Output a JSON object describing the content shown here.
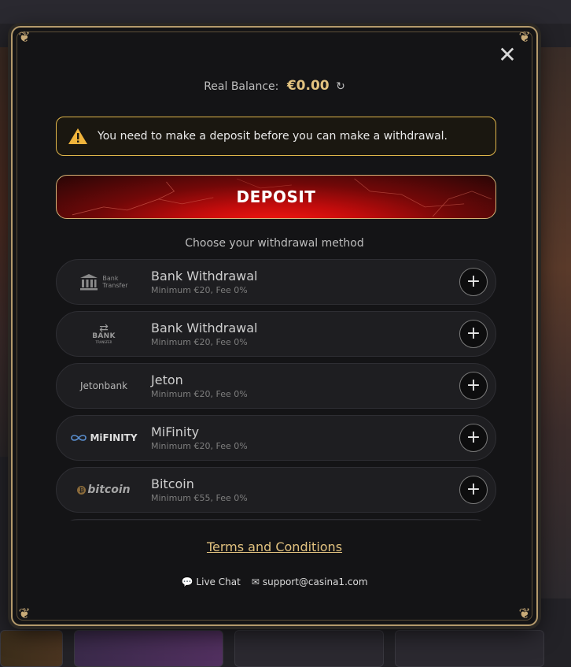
{
  "modal": {
    "close_icon": "close-icon",
    "balance": {
      "label": "Real Balance:",
      "amount": "€0.00",
      "refresh_icon": "refresh-icon"
    },
    "warning": {
      "icon": "warning-triangle-icon",
      "text": "You need to make a deposit before you can make a withdrawal.",
      "border_color": "#e0b54a"
    },
    "deposit_button": "DEPOSIT",
    "choose_label": "Choose your withdrawal method",
    "methods": [
      {
        "logo": "bank-transfer-logo",
        "logo_text": [
          "Bank",
          "Transfer"
        ],
        "name": "Bank Withdrawal",
        "minimum": "Minimum €20,",
        "fee": "Fee 0%"
      },
      {
        "logo": "bank-transfer-2-logo",
        "logo_text": [
          "BANK",
          "TRANSFER"
        ],
        "name": "Bank Withdrawal",
        "minimum": "Minimum €20,",
        "fee": "Fee 0%"
      },
      {
        "logo": "jetonbank-logo",
        "logo_text": [
          "Jetonbank"
        ],
        "name": "Jeton",
        "minimum": "Minimum €20,",
        "fee": "Fee 0%"
      },
      {
        "logo": "mifinity-logo",
        "logo_text": [
          "MiFINITY"
        ],
        "name": "MiFinity",
        "minimum": "Minimum €20,",
        "fee": "Fee 0%"
      },
      {
        "logo": "bitcoin-logo",
        "logo_text": [
          "bitcoin"
        ],
        "name": "Bitcoin",
        "minimum": "Minimum €55,",
        "fee": "Fee 0%"
      }
    ],
    "terms_link": "Terms and Conditions",
    "footer": {
      "live_chat": "Live Chat",
      "email": "support@casina1.com"
    },
    "accent_color": "#e2c27f"
  }
}
